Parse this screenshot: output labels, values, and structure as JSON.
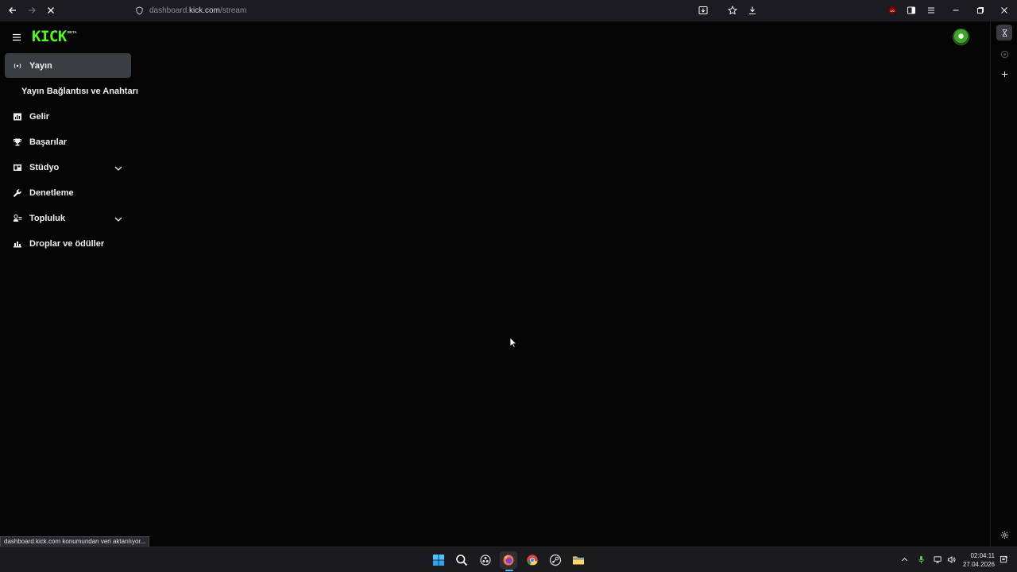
{
  "browser": {
    "url_prefix": "dashboard.",
    "url_domain": "kick.com",
    "url_path": "/stream",
    "status_text": "dashboard.kick.com konumundan veri aktarılıyor..."
  },
  "app": {
    "logo": "KICK",
    "logo_badge": "BETA",
    "brand_color": "#53fc18"
  },
  "sidebar": {
    "items": [
      {
        "label": "Yayın",
        "icon": "stream-icon",
        "active": true
      },
      {
        "label": "Yayın Bağlantısı ve Anahtarı",
        "icon": "",
        "active": false
      },
      {
        "label": "Gelir",
        "icon": "chart-icon",
        "active": false
      },
      {
        "label": "Başarılar",
        "icon": "trophy-icon",
        "active": false
      },
      {
        "label": "Stüdyo",
        "icon": "studio-icon",
        "active": false,
        "expandable": true
      },
      {
        "label": "Denetleme",
        "icon": "wrench-icon",
        "active": false
      },
      {
        "label": "Topluluk",
        "icon": "community-icon",
        "active": false,
        "expandable": true
      },
      {
        "label": "Droplar ve ödüller",
        "icon": "drops-icon",
        "active": false
      }
    ]
  },
  "taskbar": {
    "time": "02:04:11",
    "date": "27.04.2026"
  }
}
